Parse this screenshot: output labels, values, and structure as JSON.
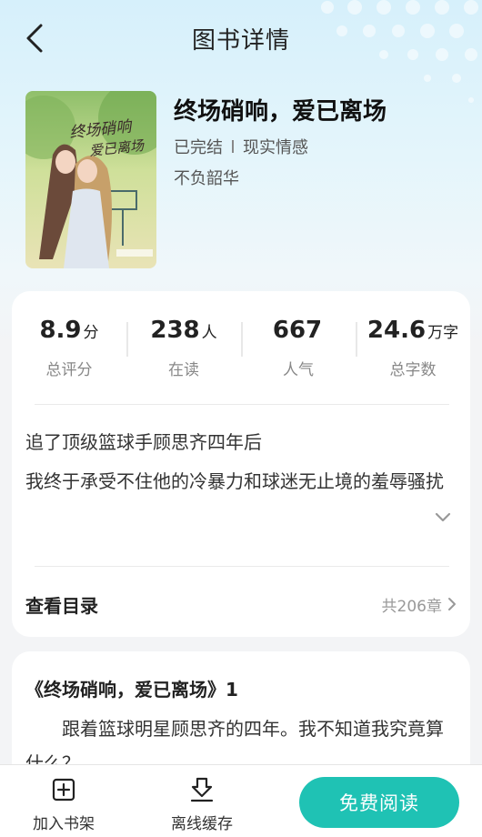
{
  "header": {
    "title": "图书详情"
  },
  "book": {
    "title": "终场硝响，爱已离场",
    "status": "已完结",
    "category": "现实情感",
    "author": "不负韶华",
    "cover_text_line1": "终场硝响",
    "cover_text_line2": "爱已离场"
  },
  "stats": [
    {
      "value": "8.9",
      "unit": "分",
      "label": "总评分"
    },
    {
      "value": "238",
      "unit": "人",
      "label": "在读"
    },
    {
      "value": "667",
      "unit": "",
      "label": "人气"
    },
    {
      "value": "24.6",
      "unit": "万字",
      "label": "总字数"
    }
  ],
  "description": {
    "line1": "追了顶级篮球手顾思齐四年后",
    "line2": "我终于承受不住他的冷暴力和球迷无止境的羞辱骚扰"
  },
  "toc": {
    "label": "查看目录",
    "count": "共206章"
  },
  "preview": {
    "chapter_title": "《终场硝响，爱已离场》1",
    "text": "跟着篮球明星顾思齐的四年。我不知道我究竟算什么？"
  },
  "bottom_bar": {
    "add_shelf": "加入书架",
    "offline_cache": "离线缓存",
    "read_free": "免费阅读"
  },
  "colors": {
    "accent": "#1fc2b4"
  }
}
